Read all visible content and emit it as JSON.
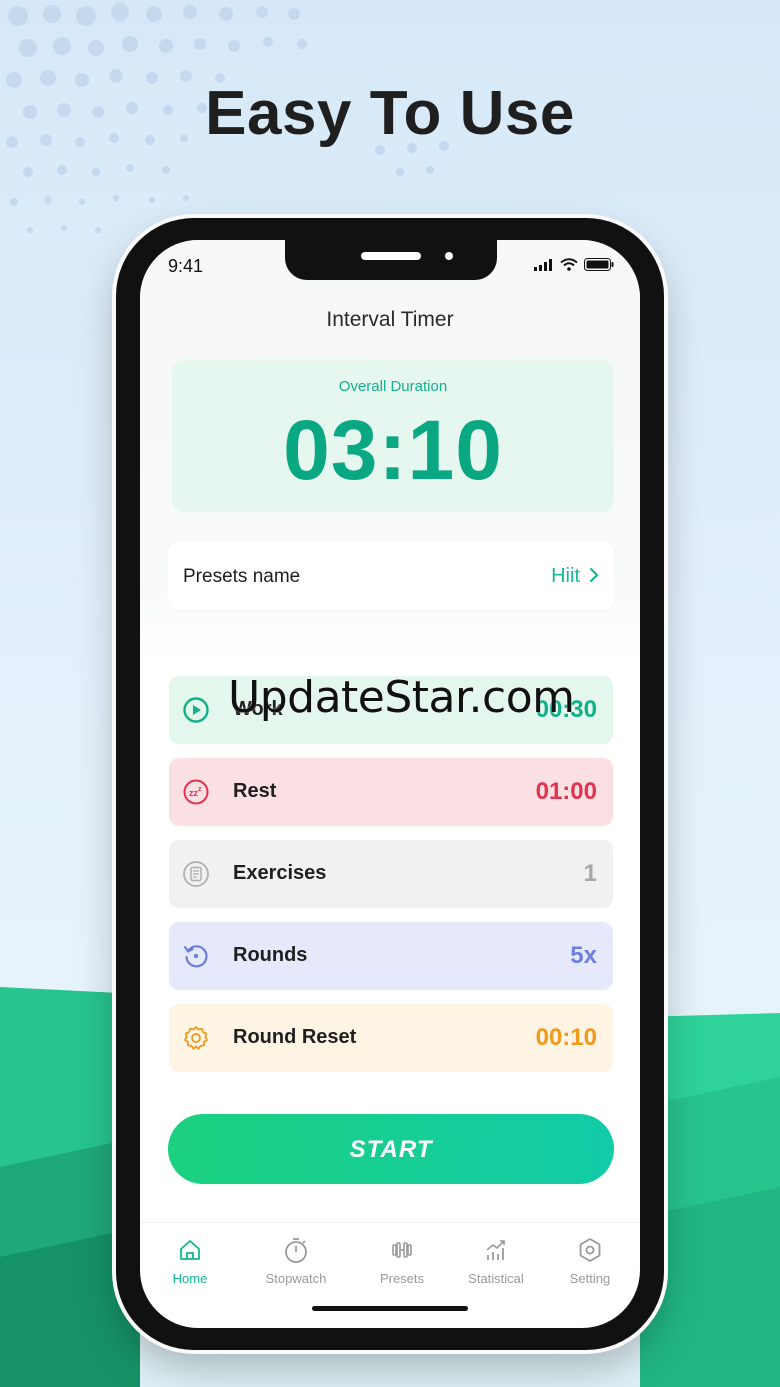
{
  "headline": "Easy To Use",
  "status_bar": {
    "time": "9:41"
  },
  "app": {
    "title": "Interval Timer"
  },
  "overall": {
    "label": "Overall Duration",
    "value": "03:10"
  },
  "preset": {
    "label": "Presets name",
    "value": "Hiit"
  },
  "rows": [
    {
      "label": "Work",
      "value": "00:30",
      "icon": "play-circle-icon",
      "bg": "#e4f7ec",
      "color": "#12b08a"
    },
    {
      "label": "Rest",
      "value": "01:00",
      "icon": "sleep-icon",
      "bg": "#fbe0e3",
      "color": "#e2324f"
    },
    {
      "label": "Exercises",
      "value": "1",
      "icon": "list-icon",
      "bg": "#f1f1f2",
      "color": "#a8a8a8"
    },
    {
      "label": "Rounds",
      "value": "5x",
      "icon": "rotate-icon",
      "bg": "#e6e9fb",
      "color": "#6c7fe0"
    },
    {
      "label": "Round Reset",
      "value": "00:10",
      "icon": "gear-icon",
      "bg": "#fdf4e3",
      "color": "#ee9a1c"
    }
  ],
  "start_button": "START",
  "tabs": [
    {
      "label": "Home",
      "icon": "home-icon",
      "active": true
    },
    {
      "label": "Stopwatch",
      "icon": "stopwatch-icon",
      "active": false
    },
    {
      "label": "Presets",
      "icon": "dumbbell-icon",
      "active": false
    },
    {
      "label": "Statistical",
      "icon": "chart-icon",
      "active": false
    },
    {
      "label": "Setting",
      "icon": "settings-icon",
      "active": false
    }
  ],
  "watermark": "UpdateStar.com",
  "colors": {
    "accent": "#12b891",
    "start_gradient_from": "#1bd17f",
    "start_gradient_to": "#12cba8"
  }
}
